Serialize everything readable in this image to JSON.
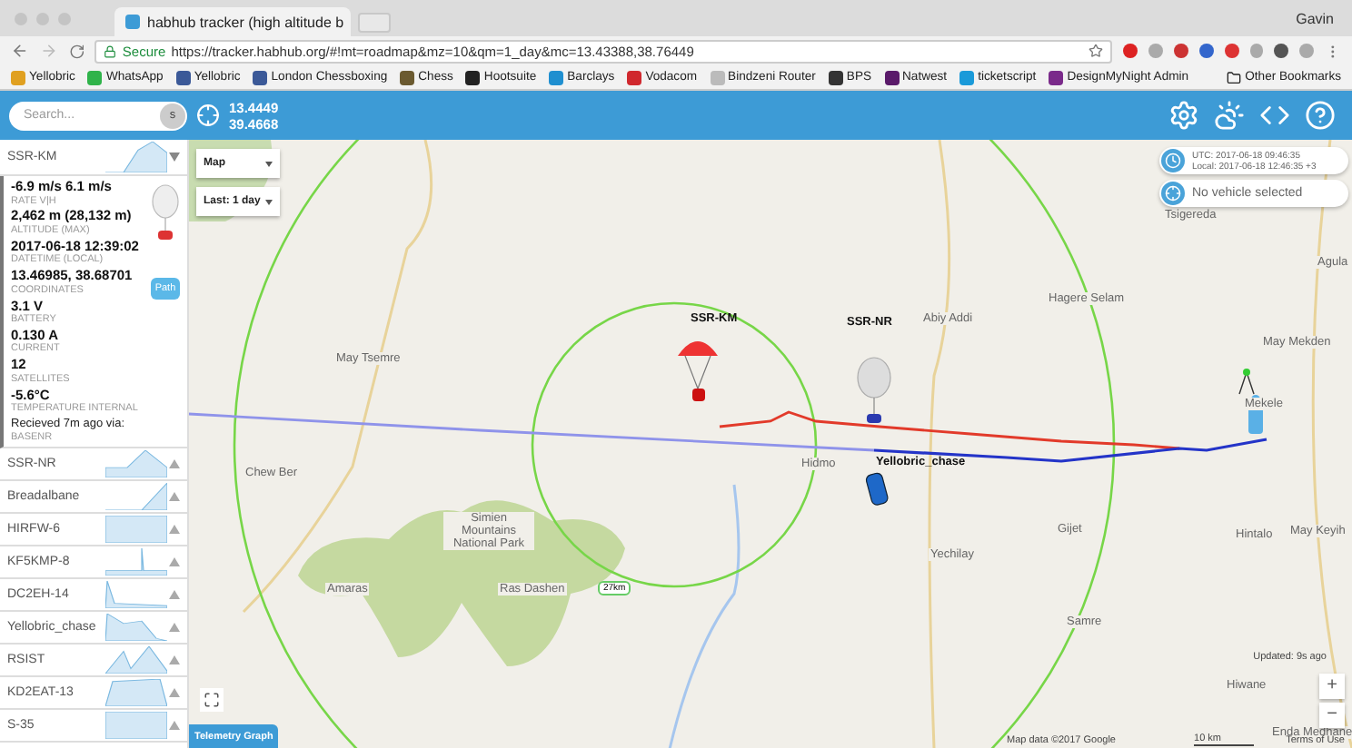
{
  "browser": {
    "tab_title": "habhub tracker (high altitude b",
    "user": "Gavin",
    "secure": "Secure",
    "url": "https://tracker.habhub.org/#!mt=roadmap&mz=10&qm=1_day&mc=13.43388,38.76449",
    "bookmarks": [
      {
        "label": "Yellobric",
        "color": "#e0a020"
      },
      {
        "label": "WhatsApp",
        "color": "#2fb34a"
      },
      {
        "label": "Yellobric",
        "color": "#3b5998"
      },
      {
        "label": "London Chessboxing",
        "color": "#3b5998"
      },
      {
        "label": "Chess",
        "color": "#6b5a30"
      },
      {
        "label": "Hootsuite",
        "color": "#222222"
      },
      {
        "label": "Barclays",
        "color": "#1f8fd0"
      },
      {
        "label": "Vodacom",
        "color": "#d0282e"
      },
      {
        "label": "Bindzeni Router",
        "color": "#bbbbbb"
      },
      {
        "label": "BPS",
        "color": "#333333"
      },
      {
        "label": "Natwest",
        "color": "#5a1a6a"
      },
      {
        "label": "ticketscript",
        "color": "#1a9ad9"
      },
      {
        "label": "DesignMyNight Admin",
        "color": "#7a2a8a"
      }
    ],
    "other_bookmarks": "Other Bookmarks"
  },
  "header": {
    "search_placeholder": "Search...",
    "search_button": "s",
    "latitude": "13.4449",
    "longitude": "39.4668"
  },
  "vehicles": [
    {
      "name": "SSR-KM",
      "expanded": true,
      "fields": [
        {
          "value": "-6.9 m/s 6.1 m/s",
          "label": "RATE V|H"
        },
        {
          "value": "2,462 m (28,132 m)",
          "label": "ALTITUDE (MAX)"
        },
        {
          "value": "2017-06-18 12:39:02",
          "label": "DATETIME (LOCAL)"
        },
        {
          "value": "13.46985, 38.68701",
          "label": "COORDINATES"
        },
        {
          "value": "3.1 V",
          "label": "BATTERY"
        },
        {
          "value": "0.130 A",
          "label": "CURRENT"
        },
        {
          "value": "12",
          "label": "SATELLITES"
        },
        {
          "value": "-5.6°C",
          "label": "TEMPERATURE INTERNAL"
        }
      ],
      "received": "Recieved 7m ago via:",
      "receiver": "BASENR",
      "path_button": "Path"
    },
    {
      "name": "SSR-NR",
      "expanded": false
    },
    {
      "name": "Breadalbane",
      "expanded": false
    },
    {
      "name": "HIRFW-6",
      "expanded": false
    },
    {
      "name": "KF5KMP-8",
      "expanded": false
    },
    {
      "name": "DC2EH-14",
      "expanded": false
    },
    {
      "name": "Yellobric_chase",
      "expanded": false
    },
    {
      "name": "RSIST",
      "expanded": false
    },
    {
      "name": "KD2EAT-13",
      "expanded": false
    },
    {
      "name": "S-35",
      "expanded": false
    }
  ],
  "map": {
    "map_type": "Map",
    "period": "Last: 1 day",
    "utc": "UTC: 2017-06-18 09:46:35",
    "local": "Local: 2017-06-18 12:46:35 +3",
    "selected_vehicle": "No vehicle selected",
    "places": [
      {
        "name": "May Tsemre"
      },
      {
        "name": "Chew Ber"
      },
      {
        "name": "Simien Mountains National Park"
      },
      {
        "name": "Amaras"
      },
      {
        "name": "Ras Dashen"
      },
      {
        "name": "Hidmo"
      },
      {
        "name": "Abiy Addi"
      },
      {
        "name": "Hagere Selam"
      },
      {
        "name": "Tsigereda"
      },
      {
        "name": "Agula"
      },
      {
        "name": "May Mekden"
      },
      {
        "name": "Mekele"
      },
      {
        "name": "Gijet"
      },
      {
        "name": "Yechilay"
      },
      {
        "name": "Hintalo"
      },
      {
        "name": "May Keyih"
      },
      {
        "name": "Samre"
      },
      {
        "name": "Hiwane"
      },
      {
        "name": "Enda Medhane"
      }
    ],
    "markers": [
      {
        "label": "SSR-KM",
        "kind": "parachute"
      },
      {
        "label": "SSR-NR",
        "kind": "balloon"
      },
      {
        "label": "Yellobric_chase",
        "kind": "car"
      }
    ],
    "range_label": "27km",
    "updated": "Updated: 9s ago",
    "zoom_in": "+",
    "zoom_out": "−",
    "attribution": "Map data ©2017 Google",
    "scale": "10 km",
    "terms": "Terms of Use",
    "telemetry_button": "Telemetry Graph"
  }
}
